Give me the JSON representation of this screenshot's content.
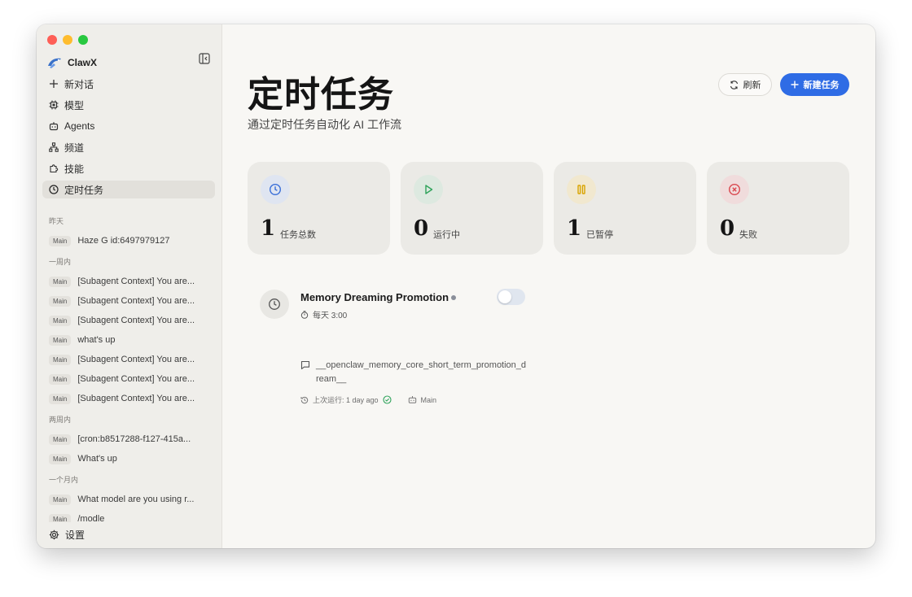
{
  "app": {
    "name": "ClawX"
  },
  "nav": {
    "new_chat": "新对话",
    "models": "模型",
    "agents": "Agents",
    "channels": "频道",
    "skills": "技能",
    "cron": "定时任务",
    "settings": "设置"
  },
  "history": {
    "groups": [
      {
        "label": "昨天",
        "items": [
          {
            "badge": "Main",
            "title": "Haze G id:6497979127"
          }
        ]
      },
      {
        "label": "一周内",
        "items": [
          {
            "badge": "Main",
            "title": "[Subagent Context] You are..."
          },
          {
            "badge": "Main",
            "title": "[Subagent Context] You are..."
          },
          {
            "badge": "Main",
            "title": "[Subagent Context] You are..."
          },
          {
            "badge": "Main",
            "title": "what's up"
          },
          {
            "badge": "Main",
            "title": "[Subagent Context] You are..."
          },
          {
            "badge": "Main",
            "title": "[Subagent Context] You are..."
          },
          {
            "badge": "Main",
            "title": "[Subagent Context] You are..."
          }
        ]
      },
      {
        "label": "两周内",
        "items": [
          {
            "badge": "Main",
            "title": "[cron:b8517288-f127-415a..."
          },
          {
            "badge": "Main",
            "title": "What's up"
          }
        ]
      },
      {
        "label": "一个月内",
        "items": [
          {
            "badge": "Main",
            "title": "What model are you using r..."
          },
          {
            "badge": "Main",
            "title": "/modle"
          }
        ]
      }
    ]
  },
  "page": {
    "title": "定时任务",
    "subtitle": "通过定时任务自动化 AI 工作流",
    "refresh_label": "刷新",
    "new_task_label": "新建任务"
  },
  "stats": [
    {
      "value": "1",
      "label": "任务总数",
      "icon": "clock-icon",
      "color": "#3a6fd8",
      "bg": "#dfe5f1"
    },
    {
      "value": "0",
      "label": "运行中",
      "icon": "play-icon",
      "color": "#2fa35b",
      "bg": "#dde9e0"
    },
    {
      "value": "1",
      "label": "已暂停",
      "icon": "pause-icon",
      "color": "#d9a400",
      "bg": "#f1e8cf"
    },
    {
      "value": "0",
      "label": "失败",
      "icon": "x-circle-icon",
      "color": "#d9484f",
      "bg": "#f0dcdc"
    }
  ],
  "task": {
    "name": "Memory Dreaming Promotion",
    "schedule": "每天 3:00",
    "message": "__openclaw_memory_core_short_term_promotion_dream__",
    "last_run": "上次运行: 1 day ago",
    "agent": "Main",
    "enabled": false
  }
}
